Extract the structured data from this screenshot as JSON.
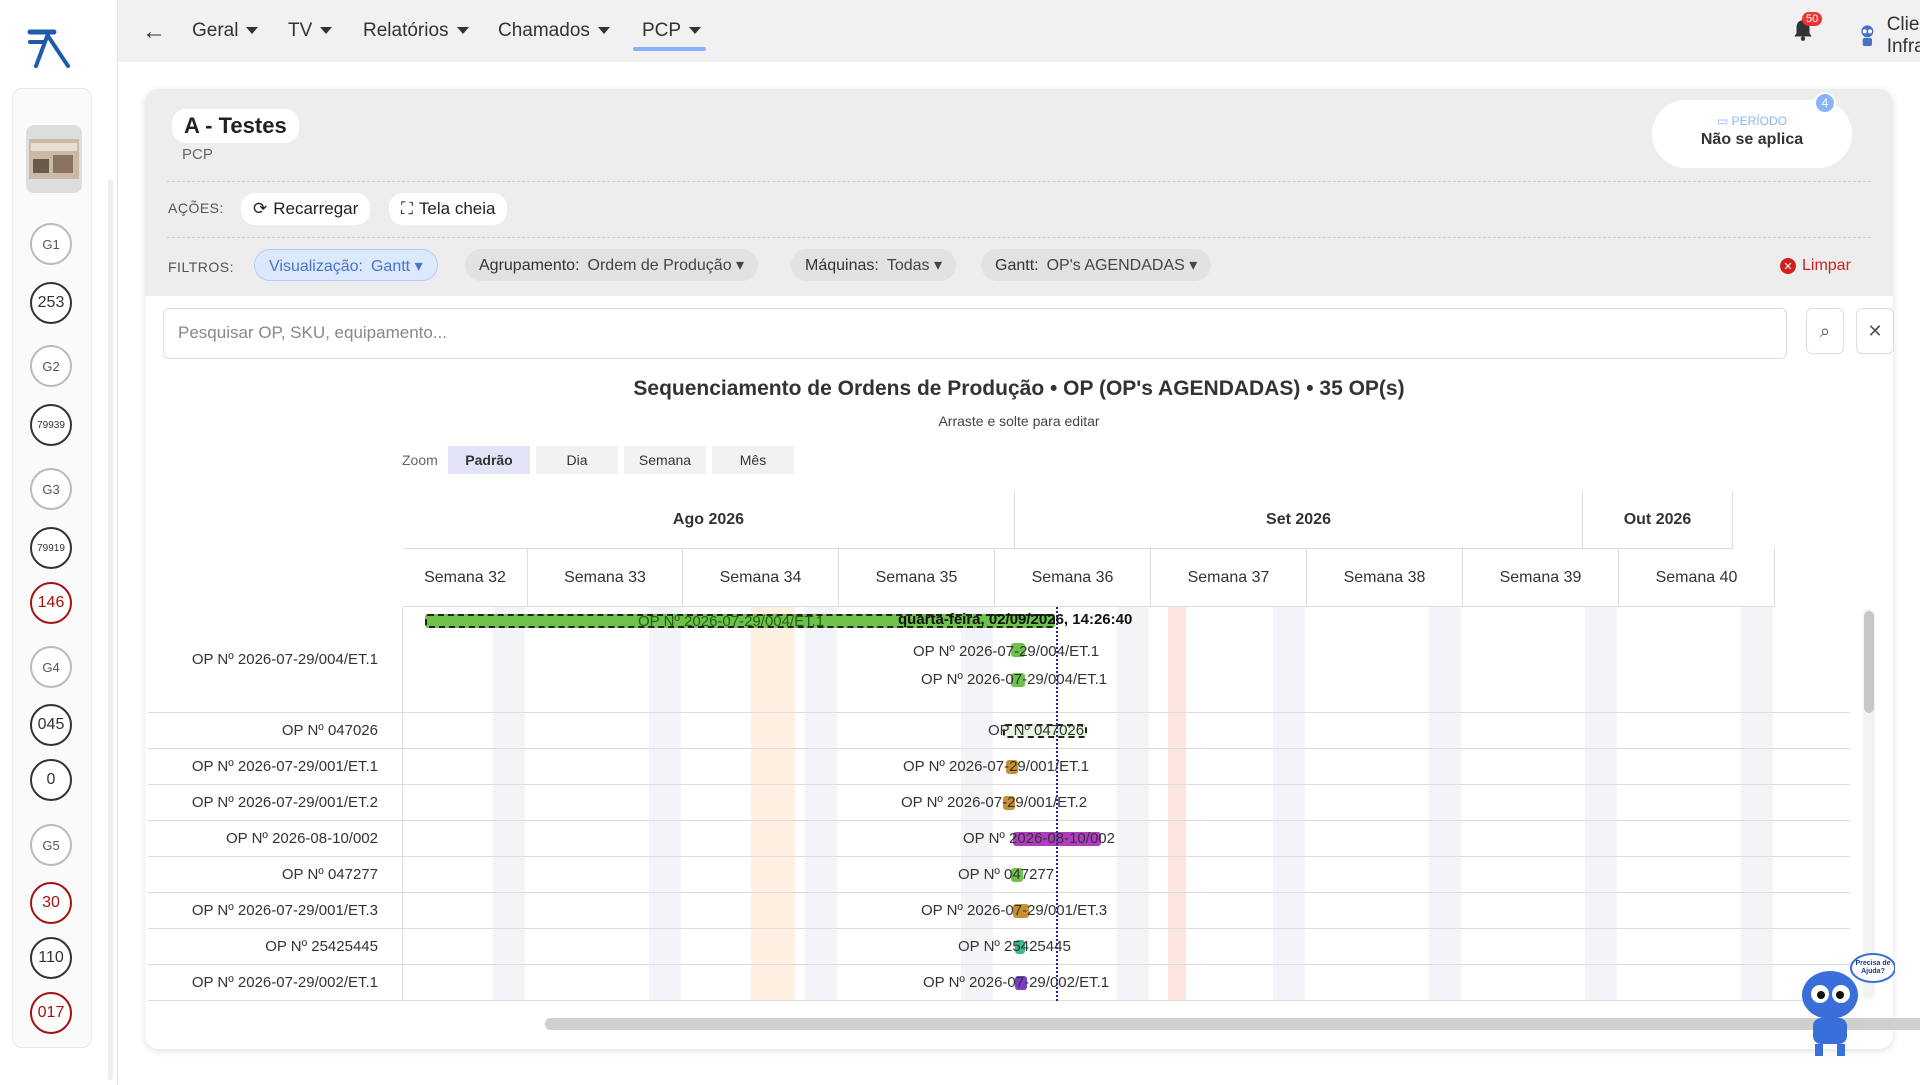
{
  "nav": {
    "items": [
      "Geral",
      "TV",
      "Relatórios",
      "Chamados",
      "PCP"
    ],
    "notifications": "50",
    "user_name": "Cliente Infra"
  },
  "sidebar": {
    "items": [
      "G1",
      "253",
      "G2",
      "79939",
      "G3",
      "79919",
      "146",
      "G4",
      "045",
      "0",
      "G5",
      "30",
      "110",
      "017"
    ]
  },
  "page": {
    "title": "A - Testes",
    "subtitle": "PCP",
    "periodo_label": "PERÍODO",
    "periodo_value": "Não se aplica",
    "periodo_badge": "4"
  },
  "actions": {
    "label": "AÇÕES:",
    "reload": "Recarregar",
    "fullscreen": "Tela cheia"
  },
  "filters": {
    "label": "FILTROS:",
    "visualizacao_key": "Visualização:",
    "visualizacao_val": "Gantt",
    "agrupamento_key": "Agrupamento:",
    "agrupamento_val": "Ordem de Produção",
    "maquinas_key": "Máquinas:",
    "maquinas_val": "Todas",
    "gantt_key": "Gantt:",
    "gantt_val": "OP's AGENDADAS",
    "clear": "Limpar"
  },
  "search": {
    "placeholder": "Pesquisar OP, SKU, equipamento..."
  },
  "chart": {
    "title": "Sequenciamento de Ordens de Produção • OP (OP's AGENDADAS) • 35 OP(s)",
    "subtitle": "Arraste e solte para editar",
    "zoom_label": "Zoom",
    "zoom_options": [
      "Padrão",
      "Dia",
      "Semana",
      "Mês"
    ],
    "months": [
      "Ago 2026",
      "Set 2026",
      "Out 2026"
    ],
    "weeks": [
      "Semana 32",
      "Semana 33",
      "Semana 34",
      "Semana 35",
      "Semana 36",
      "Semana 37",
      "Semana 38",
      "Semana 39",
      "Semana 40"
    ],
    "current_time": "quarta-feira, 02/09/2026, 14:26:40",
    "rows": [
      {
        "label": "OP Nº 2026-07-29/004/ET.1",
        "bars": [
          "OP Nº 2026-07-29/004/ET.1",
          "OP Nº 2026-07-29/004/ET.1",
          "OP Nº 2026-07-29/004/ET.1"
        ]
      },
      {
        "label": "OP Nº 047026",
        "bars": [
          "OP Nº 047026"
        ]
      },
      {
        "label": "OP Nº 2026-07-29/001/ET.1",
        "bars": [
          "OP Nº 2026-07-29/001/ET.1"
        ]
      },
      {
        "label": "OP Nº 2026-07-29/001/ET.2",
        "bars": [
          "OP Nº 2026-07-29/001/ET.2"
        ]
      },
      {
        "label": "OP Nº 2026-08-10/002",
        "bars": [
          "OP Nº 2026-08-10/002"
        ]
      },
      {
        "label": "OP Nº 047277",
        "bars": [
          "OP Nº 047277"
        ]
      },
      {
        "label": "OP Nº 2026-07-29/001/ET.3",
        "bars": [
          "OP Nº 2026-07-29/001/ET.3"
        ]
      },
      {
        "label": "OP Nº 25425445",
        "bars": [
          "OP Nº 25425445"
        ]
      },
      {
        "label": "OP Nº 2026-07-29/002/ET.1",
        "bars": [
          "OP Nº 2026-07-29/002/ET.1"
        ]
      }
    ],
    "colors": {
      "green": "#6cc24a",
      "orange": "#c9902f",
      "magenta": "#b13cc0",
      "teal": "#3cb88a",
      "purple": "#7a3fc8"
    }
  },
  "mascot": {
    "text": "Precisa de Ajuda?"
  }
}
